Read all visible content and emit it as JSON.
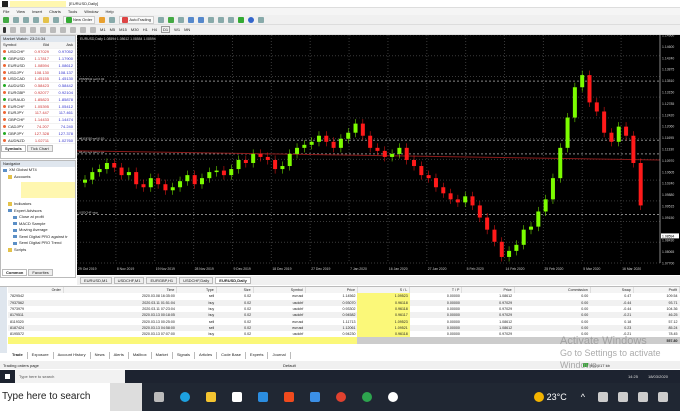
{
  "window": {
    "title": "[EURUSD,Daily]"
  },
  "menu": [
    "File",
    "View",
    "Insert",
    "Charts",
    "Tools",
    "Window",
    "Help"
  ],
  "toolbar": {
    "new_order": "New Order",
    "auto_trading": "AutoTrading",
    "periods": [
      "M1",
      "M5",
      "M15",
      "M30",
      "H1",
      "H4",
      "D1",
      "W1",
      "MN"
    ]
  },
  "market_watch": {
    "title": "Market Watch: 23:24:34",
    "columns": [
      "Symbol",
      "Bid",
      "Ask"
    ],
    "rows": [
      {
        "symbol": "USDCHF",
        "bid": "0.97029",
        "ask": "0.97052",
        "up": false
      },
      {
        "symbol": "GBPUSD",
        "bid": "1.17817",
        "ask": "1.17900",
        "up": true
      },
      {
        "symbol": "EURUSD",
        "bid": "1.08594",
        "ask": "1.08612",
        "up": false
      },
      {
        "symbol": "USDJPY",
        "bid": "108.130",
        "ask": "108.137",
        "up": false
      },
      {
        "symbol": "USDCAD",
        "bid": "1.45155",
        "ask": "1.45130",
        "up": false
      },
      {
        "symbol": "AUDUSD",
        "bid": "0.58423",
        "ask": "0.58442",
        "up": true
      },
      {
        "symbol": "EURGBP",
        "bid": "0.92077",
        "ask": "0.92104",
        "up": false
      },
      {
        "symbol": "EURAUD",
        "bid": "1.85823",
        "ask": "1.85878",
        "up": true
      },
      {
        "symbol": "EURCHF",
        "bid": "1.05395",
        "ask": "1.05412",
        "up": false
      },
      {
        "symbol": "EURJPY",
        "bid": "117.447",
        "ask": "117.461",
        "up": false
      },
      {
        "symbol": "GBPCHF",
        "bid": "1.14433",
        "ask": "1.14474",
        "up": false
      },
      {
        "symbol": "CADJPY",
        "bid": "74.207",
        "ask": "74.240",
        "up": false
      },
      {
        "symbol": "GBPJPY",
        "bid": "127.328",
        "ask": "127.378",
        "up": true
      },
      {
        "symbol": "AUDNZD",
        "bid": "1.02711",
        "ask": "1.02760",
        "up": false
      }
    ],
    "tabs": [
      "Symbols",
      "Tick Chart"
    ]
  },
  "navigator": {
    "title": "Navigator",
    "items": [
      {
        "label": "XM Global MT4",
        "level": 0,
        "icon": "terminal"
      },
      {
        "label": "Accounts",
        "level": 1,
        "icon": "folder"
      },
      {
        "label": "Indicators",
        "level": 1,
        "icon": "folder"
      },
      {
        "label": "Expert Advisors",
        "level": 1,
        "icon": "expert"
      },
      {
        "label": "Close at profit",
        "level": 2,
        "icon": "expert"
      },
      {
        "label": "MACD Sample",
        "level": 2,
        "icon": "expert"
      },
      {
        "label": "Moving Average",
        "level": 2,
        "icon": "expert"
      },
      {
        "label": "Semi Digital PRO against tr",
        "level": 2,
        "icon": "expert"
      },
      {
        "label": "Semi Digital PRO Trend",
        "level": 2,
        "icon": "expert"
      },
      {
        "label": "Scripts",
        "level": 1,
        "icon": "folder"
      }
    ],
    "tabs": [
      "Common",
      "Favorites"
    ]
  },
  "chart": {
    "header": "EURUSD,Daily 1.08594 1.08612 1.08584 1.08594",
    "colors": {
      "bull": "#7cfc00",
      "bear": "#ff1a1a",
      "grid": "#3a3a3a"
    },
    "closes": [
      1.1045,
      1.107,
      1.108,
      1.11,
      1.1085,
      1.106,
      1.107,
      1.103,
      1.102,
      1.105,
      1.103,
      1.101,
      1.102,
      1.104,
      1.106,
      1.103,
      1.105,
      1.107,
      1.1075,
      1.106,
      1.108,
      1.111,
      1.11,
      1.113,
      1.112,
      1.111,
      1.108,
      1.109,
      1.113,
      1.115,
      1.116,
      1.117,
      1.119,
      1.117,
      1.115,
      1.118,
      1.12,
      1.123,
      1.119,
      1.115,
      1.114,
      1.112,
      1.113,
      1.115,
      1.111,
      1.109,
      1.106,
      1.105,
      1.102,
      1.1,
      1.098,
      1.097,
      1.099,
      1.096,
      1.092,
      1.088,
      1.084,
      1.079,
      1.081,
      1.083,
      1.088,
      1.089,
      1.094,
      1.098,
      1.105,
      1.115,
      1.125,
      1.135,
      1.139,
      1.13,
      1.127,
      1.12,
      1.117,
      1.122,
      1.119,
      1.11,
      1.096
    ],
    "price_labels": [
      "1.14960",
      "1.14600",
      "1.14240",
      "1.13875",
      "1.13510",
      "1.13150",
      "1.12785",
      "1.12420",
      "1.12060",
      "1.11695",
      "1.11330",
      "1.10970",
      "1.10605",
      "1.10240",
      "1.09880",
      "1.09515",
      "1.09150",
      "1.08594",
      "1.08430",
      "1.08065",
      "1.07700"
    ],
    "current_price": "1.08594",
    "date_labels": [
      "29 Oct 2019",
      "8 Nov 2019",
      "19 Nov 2019",
      "28 Nov 2019",
      "9 Dec 2019",
      "18 Dec 2019",
      "27 Dec 2019",
      "7 Jan 2020",
      "16 Jan 2020",
      "27 Jan 2020",
      "5 Feb 2020",
      "14 Feb 2020",
      "25 Feb 2020",
      "5 Mar 2020",
      "16 Mar 2020"
    ],
    "level_labels": [
      "#7829542 sell 0.02",
      "#8119320 sell 0.02",
      "#8187424 sell 0.02",
      "USDCHF stop"
    ],
    "tabs": [
      "EURUSD,M1",
      "USDCHF,M1",
      "EURGBP,H1",
      "USDCHF,Daily",
      "EURUSD,Daily"
    ]
  },
  "terminal": {
    "columns": [
      "Order",
      "Time",
      "Type",
      "Size",
      "Symbol",
      "Price",
      "S / L",
      "T / P",
      "Price",
      "Commission",
      "Swap",
      "Profit"
    ],
    "rows": [
      [
        "7829542",
        "2020.03.08 16:35:00",
        "sell",
        "0.02",
        "eurusd",
        "1.14562",
        "1.09523",
        "0.00000",
        "1.08612",
        "0.00",
        "0.47",
        "109.54"
      ],
      [
        "7937562",
        "2020.03.11 01:51:04",
        "buy",
        "0.02",
        "usdchf",
        "0.93070",
        "0.96118",
        "0.00000",
        "0.97029",
        "0.00",
        "-0.44",
        "93.71"
      ],
      [
        "7973979",
        "2020.03.11 07:23:04",
        "buy",
        "0.02",
        "usdchf",
        "0.93302",
        "0.96118",
        "0.00000",
        "0.97029",
        "0.00",
        "-0.44",
        "104.36"
      ],
      [
        "8179511",
        "2020.03.13 00:18:05",
        "buy",
        "0.02",
        "usdchf",
        "0.94582",
        "0.96117",
        "0.00000",
        "0.97029",
        "0.00",
        "-0.21",
        "46.25"
      ],
      [
        "8119320",
        "2020.03.13 00:25:00",
        "sell",
        "0.02",
        "eurusd",
        "1.11713",
        "1.09523",
        "0.00000",
        "1.08612",
        "0.00",
        "0.18",
        "57.12"
      ],
      [
        "8187424",
        "2020.03.13 04:58:00",
        "sell",
        "0.02",
        "eurusd",
        "1.12061",
        "1.09521",
        "0.00000",
        "1.08612",
        "0.00",
        "0.23",
        "85.24"
      ],
      [
        "8195572",
        "2020.03.13 07:07:00",
        "buy",
        "0.02",
        "usdchf",
        "0.94230",
        "0.96118",
        "0.00000",
        "0.97029",
        "0.00",
        "-0.21",
        "78.45"
      ]
    ],
    "total": "557.80",
    "tabs": [
      "Trade",
      "Exposure",
      "Account History",
      "News",
      "Alerts",
      "Mailbox",
      "Market",
      "Signals",
      "Articles",
      "Code Base",
      "Experts",
      "Journal"
    ]
  },
  "status": {
    "help": "Trading orders page",
    "profile": "Default",
    "connection": "9624/17 kb"
  },
  "watermark": {
    "line1": "Activate Windows",
    "line2": "Go to Settings to activate Windows."
  },
  "inner_taskbar": {
    "search": "Type here to search",
    "time": "14:25",
    "date": "18/03/2020"
  },
  "taskbar": {
    "search": "Type here to search",
    "weather": "23°C"
  }
}
